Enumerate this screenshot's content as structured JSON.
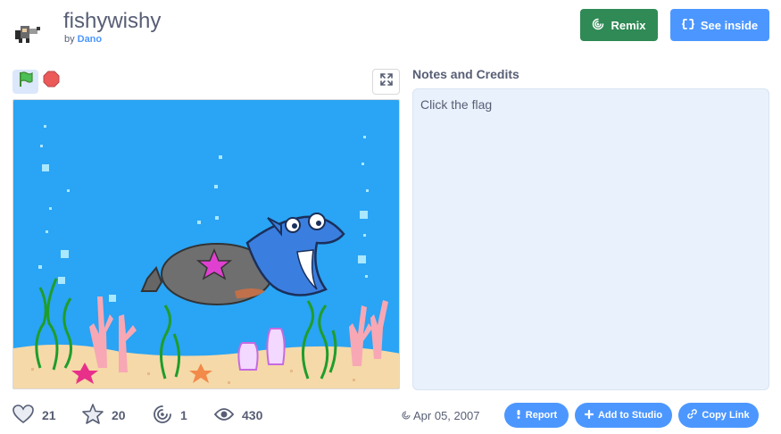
{
  "project": {
    "title": "fishywishy",
    "by_prefix": "by",
    "author": "Dano"
  },
  "actions": {
    "remix_label": "Remix",
    "see_inside_label": "See inside"
  },
  "notes": {
    "heading": "Notes and Credits",
    "text": "Click the flag"
  },
  "stats": {
    "loves": "21",
    "favorites": "20",
    "remixes": "1",
    "views": "430"
  },
  "date": "Apr 05, 2007",
  "footer_buttons": {
    "report": "Report",
    "add_to_studio": "Add to Studio",
    "copy_link": "Copy Link"
  },
  "colors": {
    "remix_green": "#2f8a55",
    "primary_blue": "#4c97ff",
    "stage_water": "#2aa4f4",
    "sand": "#f5d9a8"
  },
  "icons": {
    "green_flag": "green-flag-icon",
    "stop": "stop-icon",
    "fullscreen": "fullscreen-icon",
    "love": "heart-icon",
    "favorite": "star-icon",
    "remix": "remix-spiral-icon",
    "views": "eye-icon"
  }
}
